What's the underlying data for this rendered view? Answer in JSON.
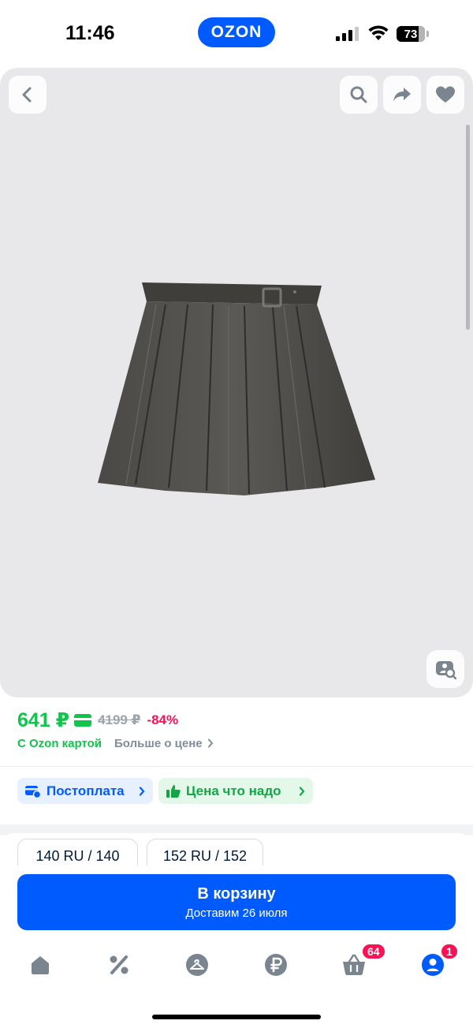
{
  "status_bar": {
    "time": "11:46",
    "brand": "OZON",
    "battery": "73"
  },
  "gallery": {
    "icons": [
      "chevron-left-icon",
      "search-icon",
      "share-icon",
      "heart-icon",
      "photo-search-icon"
    ],
    "image": "pleated-skirt-photo"
  },
  "price": {
    "main": "641 ₽",
    "old": "4199 ₽",
    "discount": "-84%",
    "with_card": "С Ozon картой",
    "more": "Больше о цене",
    "colors": {
      "green": "#10c44c",
      "discount": "#f91155",
      "gray": "#9aa4ad"
    }
  },
  "chips": {
    "postpay": "Постоплата",
    "good_price": "Цена что надо"
  },
  "sizes": [
    "140 RU / 140",
    "152 RU / 152"
  ],
  "cart": {
    "title": "В корзину",
    "subtitle": "Доставим 26 июля",
    "accent": "#005bff"
  },
  "tab_bar": {
    "cart_badge": "64",
    "profile_badge": "1",
    "icons": [
      "home-icon",
      "percent-icon",
      "hanger-icon",
      "ruble-icon",
      "basket-icon",
      "profile-icon"
    ]
  }
}
